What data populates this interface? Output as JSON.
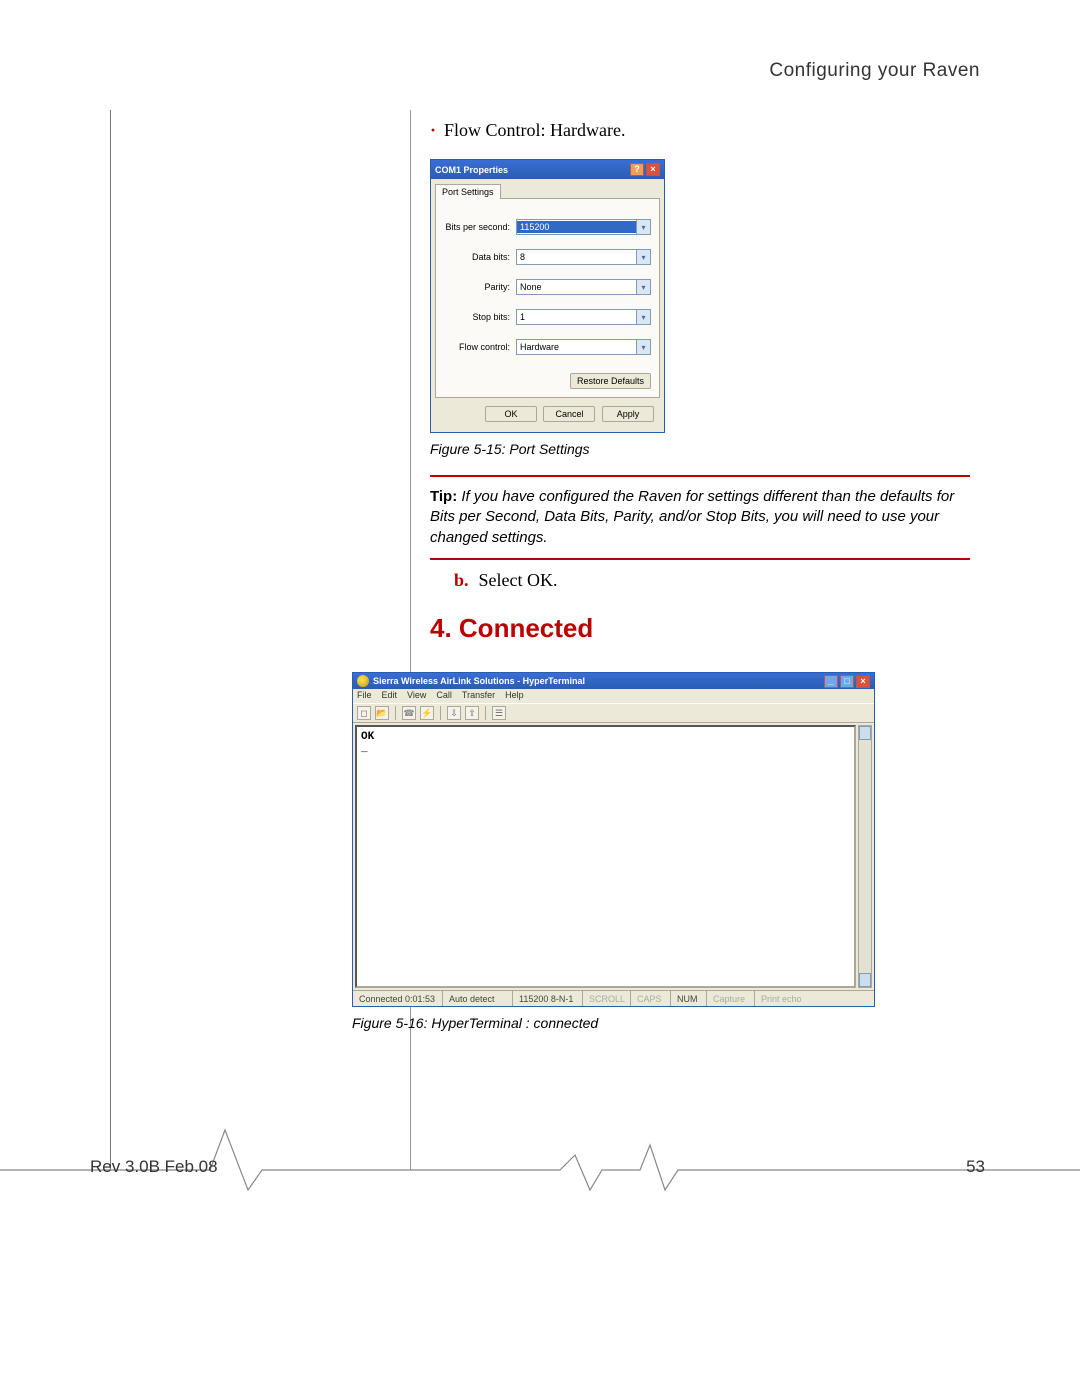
{
  "header": {
    "title": "Configuring your Raven"
  },
  "bullet": {
    "text": "Flow Control: Hardware."
  },
  "dialog": {
    "title": "COM1 Properties",
    "tab": "Port Settings",
    "fields": {
      "bits_per_second": {
        "label": "Bits per second:",
        "value": "115200"
      },
      "data_bits": {
        "label": "Data bits:",
        "value": "8"
      },
      "parity": {
        "label": "Parity:",
        "value": "None"
      },
      "stop_bits": {
        "label": "Stop bits:",
        "value": "1"
      },
      "flow_control": {
        "label": "Flow control:",
        "value": "Hardware"
      }
    },
    "restore_button": "Restore Defaults",
    "ok": "OK",
    "cancel": "Cancel",
    "apply": "Apply"
  },
  "figure15": {
    "caption": "Figure 5-15: Port Settings"
  },
  "tip": {
    "label": "Tip:",
    "text": "If you have configured the Raven for settings different than the defaults for Bits per Second, Data Bits, Parity, and/or Stop Bits, you will need to use your changed settings."
  },
  "step_b": {
    "letter": "b.",
    "text": "Select OK."
  },
  "section4": {
    "heading": "4. Connected"
  },
  "hyperterminal": {
    "title": "Sierra Wireless AirLink Solutions - HyperTerminal",
    "menu": [
      "File",
      "Edit",
      "View",
      "Call",
      "Transfer",
      "Help"
    ],
    "terminal_lines": [
      "OK",
      "_"
    ],
    "status": {
      "connected": "Connected 0:01:53",
      "auto_detect": "Auto detect",
      "settings": "115200 8-N-1",
      "scroll": "SCROLL",
      "caps": "CAPS",
      "num": "NUM",
      "capture": "Capture",
      "print_echo": "Print echo"
    }
  },
  "figure16": {
    "caption": "Figure 5-16: HyperTerminal : connected"
  },
  "footer": {
    "rev": "Rev 3.0B  Feb.08",
    "page": "53"
  }
}
